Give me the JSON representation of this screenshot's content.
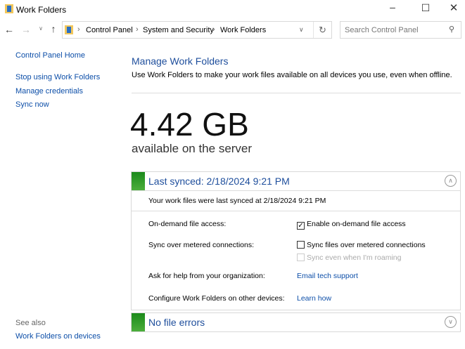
{
  "window": {
    "title": "Work Folders"
  },
  "address": {
    "crumbs": [
      "Control Panel",
      "System and Security",
      "Work Folders"
    ],
    "search_placeholder": "Search Control Panel"
  },
  "sidebar": {
    "home": "Control Panel Home",
    "items": [
      "Stop using Work Folders",
      "Manage credentials",
      "Sync now"
    ],
    "see_also": "See also",
    "see_also_link": "Work Folders on devices"
  },
  "main": {
    "title": "Manage Work Folders",
    "description": "Use Work Folders to make your work files available on all devices you use, even when offline.",
    "storage": "4.42 GB",
    "storage_label": "available on the server"
  },
  "sync_panel": {
    "header": "Last synced: 2/18/2024 9:21 PM",
    "detail": "Your work files were last synced at 2/18/2024 9:21 PM",
    "rows": [
      {
        "label": "On-demand file access:",
        "value": "Enable on-demand file access",
        "checked": true
      },
      {
        "label": "Sync over metered connections:",
        "value": "Sync files over metered connections",
        "checked": false,
        "sub": "Sync even when I'm roaming"
      },
      {
        "label": "Ask for help from your organization:",
        "value": "Email tech support"
      },
      {
        "label": "Configure Work Folders on other devices:",
        "value": "Learn how"
      }
    ]
  },
  "errors_panel": {
    "header": "No file errors"
  }
}
